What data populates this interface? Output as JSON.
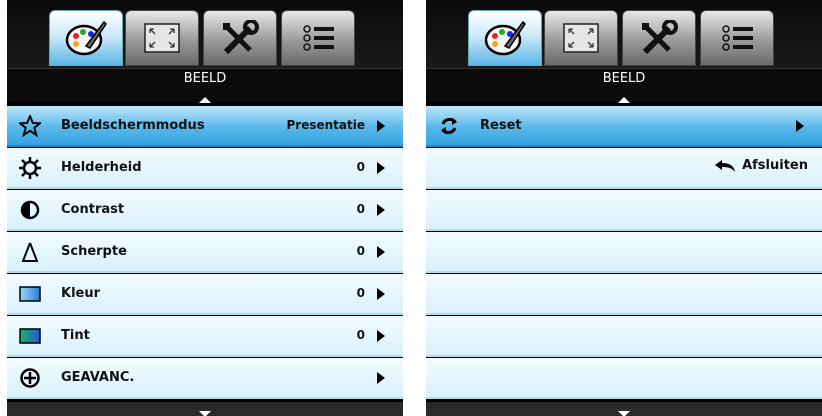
{
  "left_panel": {
    "section_title": "BEELD",
    "tabs": [
      {
        "icon": "palette-icon",
        "active": true
      },
      {
        "icon": "screen-resize-icon",
        "active": false
      },
      {
        "icon": "tools-icon",
        "active": false
      },
      {
        "icon": "list-icon",
        "active": false
      }
    ],
    "items": [
      {
        "icon": "star-icon",
        "label": "Beeldschermmodus",
        "value": "Presentatie",
        "selected": true
      },
      {
        "icon": "sun-icon",
        "label": "Helderheid",
        "value": "0",
        "selected": false
      },
      {
        "icon": "contrast-icon",
        "label": "Contrast",
        "value": "0",
        "selected": false
      },
      {
        "icon": "delta-icon",
        "label": "Scherpte",
        "value": "0",
        "selected": false
      },
      {
        "icon": "color-swatch-icon",
        "label": "Kleur",
        "value": "0",
        "selected": false
      },
      {
        "icon": "tint-swatch-icon",
        "label": "Tint",
        "value": "0",
        "selected": false
      },
      {
        "icon": "plus-circle-icon",
        "label": "GEAVANC.",
        "value": "",
        "selected": false
      }
    ]
  },
  "right_panel": {
    "section_title": "BEELD",
    "items": [
      {
        "icon": "reset-icon",
        "label": "Reset",
        "selected": true
      },
      {
        "icon": "back-arrow-icon",
        "label": "Afsluiten",
        "selected": false
      }
    ],
    "empty_rows": 6
  },
  "colors": {
    "selected_row": "#34a4e3",
    "row_bg": "#e6f6fe",
    "active_tab": "#5bb6e6"
  }
}
